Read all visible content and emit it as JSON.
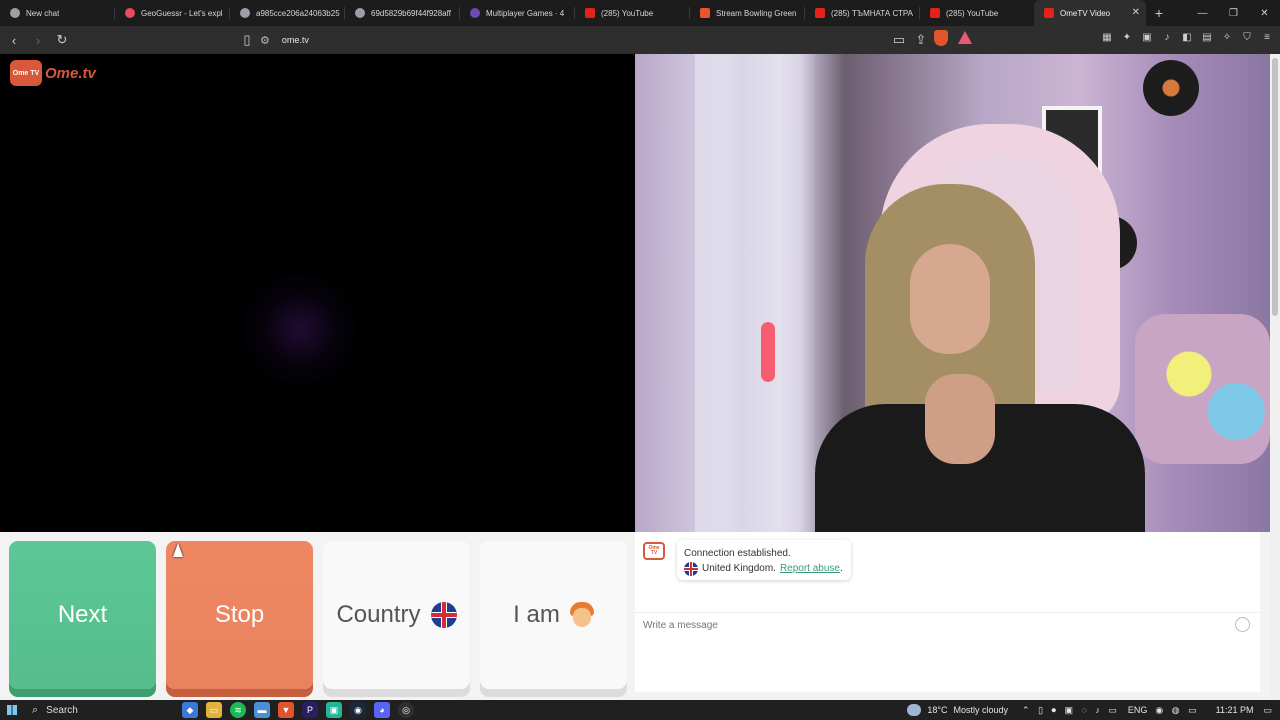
{
  "browser": {
    "tabs": [
      {
        "title": "New chat",
        "color": "#9aa0a6"
      },
      {
        "title": "GeoGuessr - Let's expl",
        "color": "#e84a5f"
      },
      {
        "title": "a985cce206a24063b25",
        "color": "#9aa0a6"
      },
      {
        "title": "69d5829b69f44f928aff",
        "color": "#9aa0a6"
      },
      {
        "title": "Multiplayer Games · 4",
        "color": "#6c4ab6"
      },
      {
        "title": "(285) YouTube",
        "color": "#e62117"
      },
      {
        "title": "Stream Bowling Green",
        "color": "#e8542b"
      },
      {
        "title": "(285) ТЪМНАТА СТРА",
        "color": "#e62117"
      },
      {
        "title": "(285) YouTube",
        "color": "#e62117"
      },
      {
        "title": "OmeTV Video",
        "color": "#e62117",
        "active": true
      }
    ],
    "url": "ome.tv"
  },
  "site": {
    "logo_badge": "Ome TV",
    "logo_text": "Ome.tv"
  },
  "controls": {
    "next_label": "Next",
    "stop_label": "Stop",
    "country_label": "Country",
    "iam_label": "I am"
  },
  "chat": {
    "system_logo": "Ome TV",
    "connection_message": "Connection established.",
    "country": "United Kingdom.",
    "report_link": "Report abuse",
    "report_suffix": ".",
    "input_placeholder": "Write a message"
  },
  "taskbar": {
    "search_label": "Search",
    "temperature": "18°C",
    "weather": "Mostly cloudy",
    "language": "ENG",
    "time": "11:21 PM"
  },
  "colors": {
    "next": "#5cc796",
    "stop": "#ee8762",
    "brand": "#d9583a",
    "link": "#3d9c78"
  }
}
